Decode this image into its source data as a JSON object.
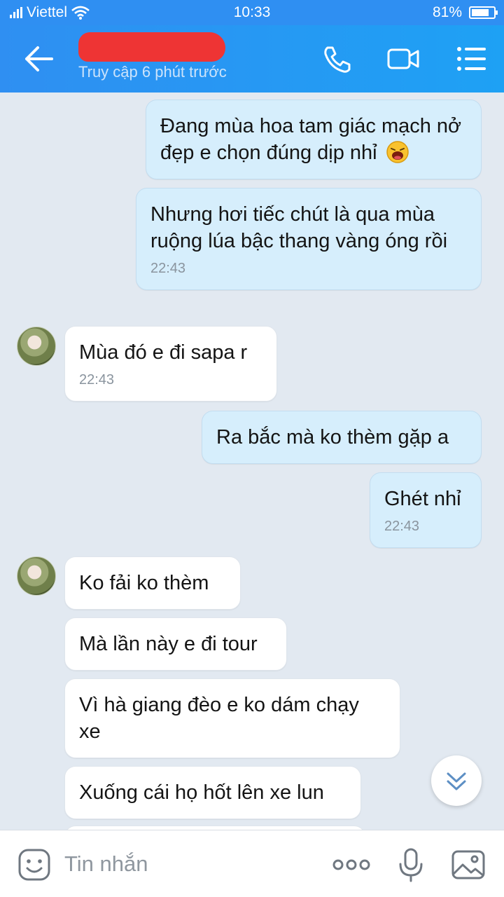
{
  "status_bar": {
    "carrier": "Viettel",
    "time": "10:33",
    "battery_percent": "81%",
    "battery_level": 0.81,
    "icons": [
      "signal-icon",
      "wifi-icon",
      "battery-icon"
    ]
  },
  "header": {
    "contact_name": "",
    "last_seen": "Truy cập 6 phút trước",
    "icons": [
      "back-arrow-icon",
      "phone-icon",
      "video-call-icon",
      "menu-list-icon"
    ]
  },
  "messages": [
    {
      "side": "me",
      "text": "Đang mùa hoa tam giác mạch nở đẹp e chọn đúng dịp nhỉ",
      "emoji": "laughing-face-icon"
    },
    {
      "side": "me",
      "text": "Nhưng hơi tiếc chút là qua mùa ruộng lúa bậc thang vàng óng rồi",
      "time": "22:43"
    },
    {
      "side": "them",
      "text": "Mùa đó e đi sapa r",
      "time": "22:43"
    },
    {
      "side": "me",
      "text": "Ra bắc mà ko thèm gặp a"
    },
    {
      "side": "me",
      "text": "Ghét nhỉ",
      "time": "22:43"
    },
    {
      "side": "them",
      "text": "Ko fải ko thèm"
    },
    {
      "side": "them",
      "text": "Mà lần này e đi tour"
    },
    {
      "side": "them",
      "text": "Vì hà giang đèo e ko dám chạy xe"
    },
    {
      "side": "them",
      "text": "Xuống cái họ hốt lên xe lun"
    }
  ],
  "composer": {
    "placeholder": "Tin nhắn",
    "icons": [
      "sticker-icon",
      "more-options-icon",
      "microphone-icon",
      "image-icon"
    ]
  },
  "colors": {
    "header": "#2f8ff2",
    "outgoing_bubble": "#d6eefc",
    "incoming_bubble": "#ffffff",
    "background": "#e2e9f1",
    "redaction": "#ee3434"
  }
}
